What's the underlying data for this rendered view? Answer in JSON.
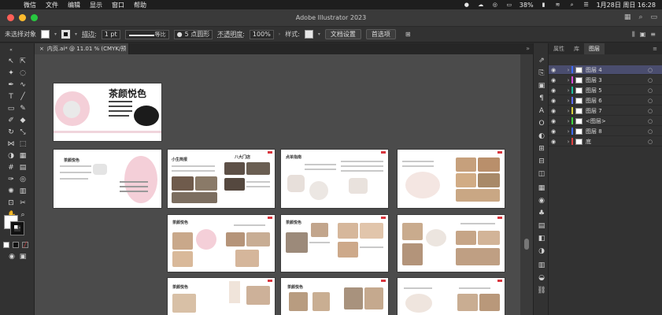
{
  "menubar": {
    "apple": "",
    "items": [
      "微信",
      "文件",
      "编辑",
      "显示",
      "窗口",
      "帮助"
    ],
    "battery": "38%",
    "datetime": "1月28日 周日 16:28"
  },
  "window": {
    "title": "Adobe Illustrator 2023"
  },
  "controlbar": {
    "selection_label": "未选择对象",
    "stroke_label": "描边:",
    "stroke_weight": "1 pt",
    "stroke_style": "等比",
    "brush": "5 点圆形",
    "opacity_label": "不透明度:",
    "opacity_value": "100%",
    "style_label": "样式:",
    "doc_setup_button": "文档设置",
    "prefs_button": "首选项"
  },
  "tab": {
    "label": "内页.ai* @ 11.01 % (CMYK/预览)"
  },
  "pages": [
    {
      "title": "茶颜悦色"
    },
    {
      "title": "茶颜悦色"
    },
    {
      "title": "小生简报"
    },
    {
      "title": "八大门店"
    },
    {
      "title": "点单指南"
    },
    {
      "title": ""
    },
    {
      "title": "茶颜悦色"
    },
    {
      "title": "茶颜悦色"
    },
    {
      "title": "茶颜悦色"
    },
    {
      "title": "茶颜悦色"
    }
  ],
  "layers_panel": {
    "tabs": [
      "属性",
      "库",
      "图层"
    ],
    "rows": [
      {
        "name": "图层 4",
        "color": "#3d6bff",
        "selected": true
      },
      {
        "name": "图层 3",
        "color": "#d94ad9"
      },
      {
        "name": "图层 5",
        "color": "#1bbf9e"
      },
      {
        "name": "图层 6",
        "color": "#5d6bff"
      },
      {
        "name": "图层 7",
        "color": "#d9d23a"
      },
      {
        "name": "<图层>",
        "color": "#3ed93e"
      },
      {
        "name": "图层 8",
        "color": "#3d6bff"
      },
      {
        "name": "底",
        "color": "#e04040"
      }
    ]
  },
  "colors": {
    "accent_pink": "#f4cfd8",
    "layer_selected": "#4a4d6e",
    "canvas_bg": "#4b4b4b"
  }
}
